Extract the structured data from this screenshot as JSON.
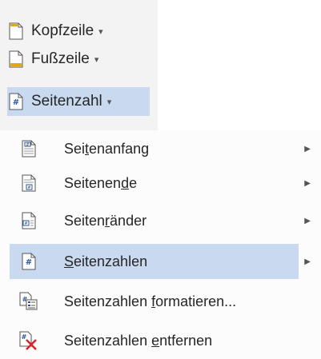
{
  "ribbon": {
    "buttons": [
      {
        "label": "Kopfzeile",
        "icon": "header-page-icon",
        "has_dropdown": true
      },
      {
        "label": "Fußzeile",
        "icon": "footer-page-icon",
        "has_dropdown": true
      },
      {
        "label": "Seitenzahl",
        "icon": "page-number-icon",
        "has_dropdown": true,
        "active": true
      }
    ],
    "dropdown_glyph": "▾"
  },
  "menu": {
    "items": [
      {
        "pre": "Sei",
        "ul": "t",
        "post": "enanfang",
        "icon": "top-of-page-icon",
        "submenu": true
      },
      {
        "pre": "Seitenen",
        "ul": "d",
        "post": "e",
        "icon": "bottom-of-page-icon",
        "submenu": true
      },
      {
        "pre": "Seiten",
        "ul": "r",
        "post": "änder",
        "icon": "page-margins-icon",
        "submenu": true
      },
      {
        "pre": "",
        "ul": "S",
        "post": "eitenzahlen",
        "icon": "current-position-icon",
        "submenu": true,
        "highlighted": true
      },
      {
        "pre": "Seitenzahlen ",
        "ul": "f",
        "post": "ormatieren...",
        "icon": "format-page-numbers-icon",
        "submenu": false
      },
      {
        "pre": "Seitenzahlen ",
        "ul": "e",
        "post": "ntfernen",
        "icon": "remove-page-numbers-icon",
        "submenu": false
      }
    ],
    "submenu_glyph": "▶"
  },
  "colors": {
    "highlight": "#c9daf0",
    "ribbon_bg": "#f3f3f3",
    "menu_bg": "#fcfcfc",
    "icon_blue": "#2b579a",
    "icon_gold": "#e8a317",
    "remove_red": "#d9252c"
  }
}
